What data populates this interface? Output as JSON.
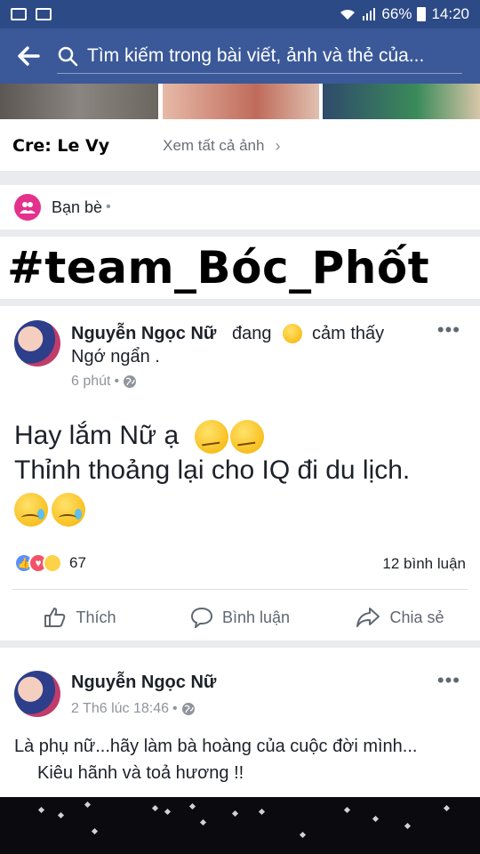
{
  "status_bar": {
    "battery": "66%",
    "time": "14:20"
  },
  "app_bar": {
    "search_placeholder": "Tìm kiếm trong bài viết, ảnh và thẻ của..."
  },
  "photo_section": {
    "credit": "Cre: Le Vy",
    "see_all": "Xem tất cả ảnh"
  },
  "audience": {
    "label": "Bạn bè",
    "dot": "•"
  },
  "hashtag_overlay": "#team_Bóc_Phốt",
  "post1": {
    "author": "Nguyễn Ngọc Nữ",
    "feeling_prefix": "đang",
    "feeling_suffix": "cảm thấy",
    "feeling_line2": "Ngớ ngẩn .",
    "time": "6 phút",
    "body_line1": "Hay lắm Nữ ạ",
    "body_line2": "Thỉnh thoảng lại cho IQ đi du lịch.",
    "reaction_count": "67",
    "comment_count": "12 bình luận",
    "actions": {
      "like": "Thích",
      "comment": "Bình luận",
      "share": "Chia sẻ"
    }
  },
  "post2": {
    "author": "Nguyễn Ngọc Nữ",
    "time": "2 Th6 lúc 18:46",
    "line1": "Là phụ nữ...hãy làm bà hoàng của cuộc đời mình...",
    "line2": "Kiêu hãnh và toả hương !!"
  },
  "colors": {
    "facebook_blue": "#3b5998",
    "status_bar": "#2c4a86",
    "friends_icon": "#e4318c",
    "like_reaction": "#5890ff",
    "love_reaction": "#f25268",
    "haha_reaction": "#fcd249"
  },
  "icons": [
    "back-arrow-icon",
    "search-icon",
    "chevron-right-icon",
    "friends-icon",
    "globe-icon",
    "more-icon",
    "like-icon",
    "comment-icon",
    "share-icon"
  ]
}
